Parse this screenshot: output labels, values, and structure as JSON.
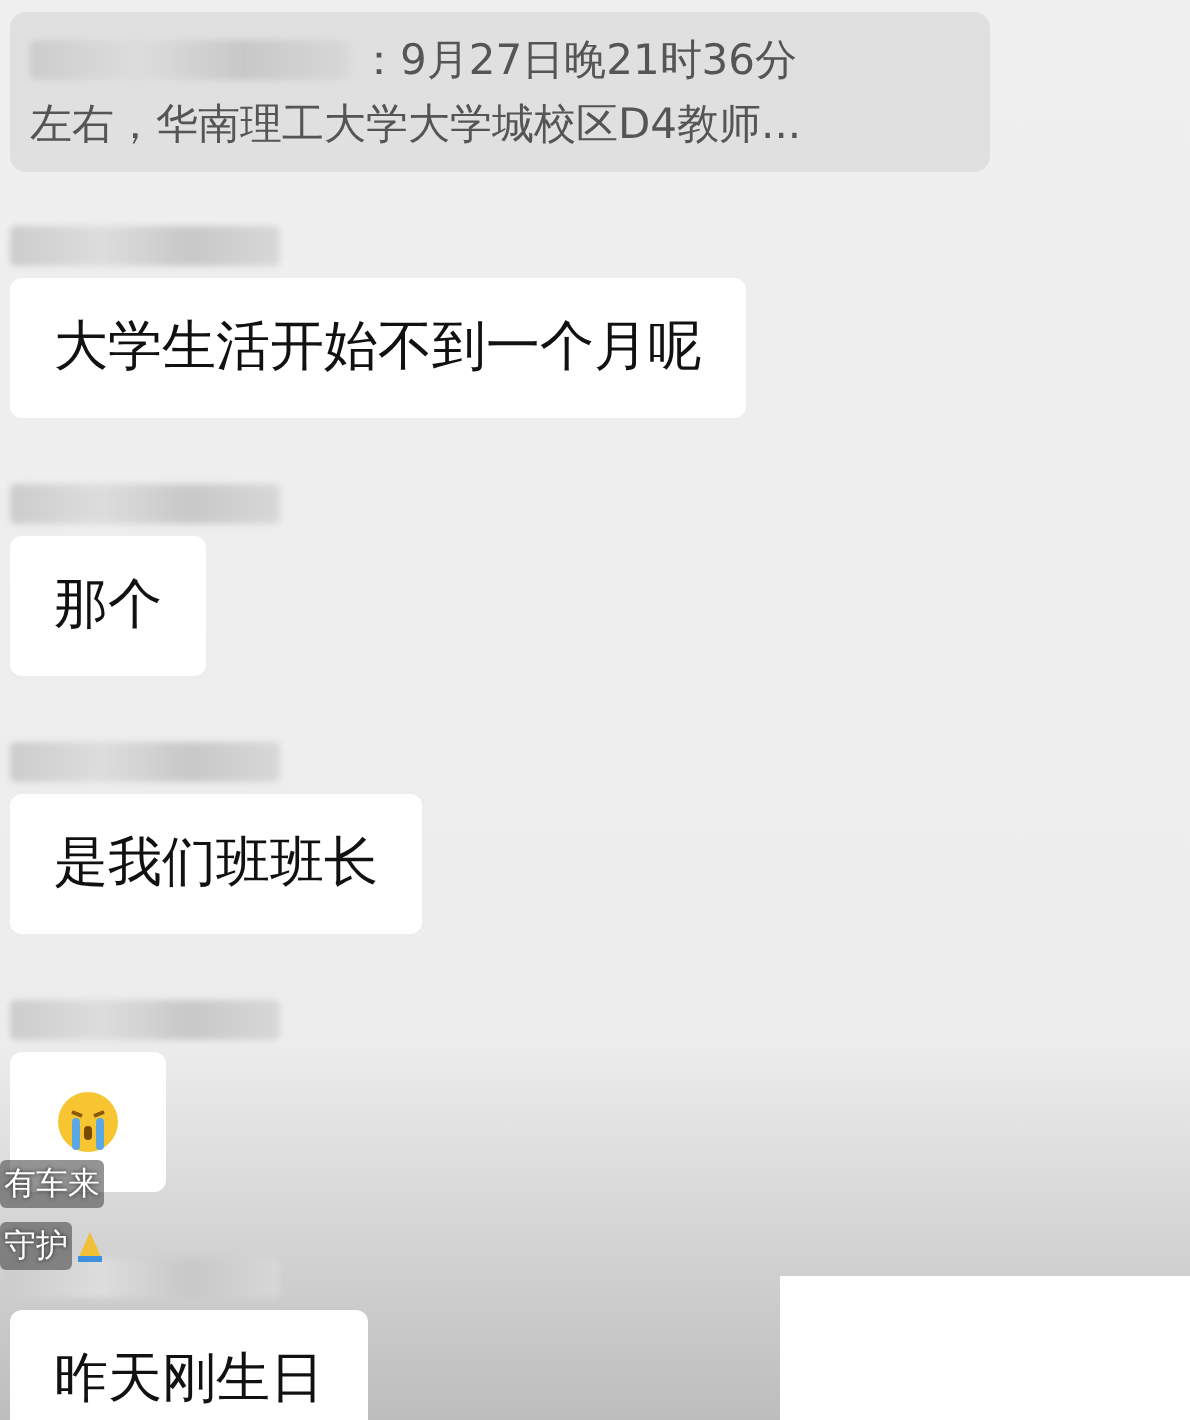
{
  "quote": {
    "lines": [
      "：9月27日晚21时36分",
      "左右，华南理工大学大学城校区D4教师..."
    ]
  },
  "messages": [
    {
      "kind": "text",
      "text": "大学生活开始不到一个月呢"
    },
    {
      "kind": "text",
      "text": "那个"
    },
    {
      "kind": "text",
      "text": "是我们班班长"
    },
    {
      "kind": "emoji"
    },
    {
      "kind": "text",
      "text": "昨天刚生日"
    }
  ],
  "overlay_captions": [
    {
      "text": "有车来",
      "pray": false
    },
    {
      "text": "守护",
      "pray": true
    }
  ]
}
